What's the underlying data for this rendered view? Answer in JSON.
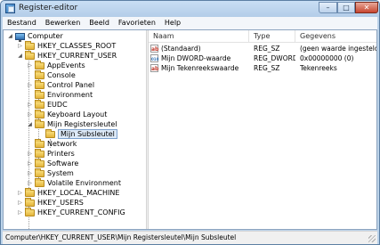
{
  "window": {
    "title": "Register-editor",
    "controls": {
      "minimize": "–",
      "maximize": "□",
      "close": "✕"
    }
  },
  "menu": [
    "Bestand",
    "Bewerken",
    "Beeld",
    "Favorieten",
    "Help"
  ],
  "tree": {
    "root": "Computer",
    "items": [
      {
        "label": "HKEY_CLASSES_ROOT",
        "expander": "▷"
      },
      {
        "label": "HKEY_CURRENT_USER",
        "expander": "◢"
      },
      {
        "label": "AppEvents",
        "expander": "▷"
      },
      {
        "label": "Console",
        "expander": ""
      },
      {
        "label": "Control Panel",
        "expander": "▷"
      },
      {
        "label": "Environment",
        "expander": ""
      },
      {
        "label": "EUDC",
        "expander": "▷"
      },
      {
        "label": "Keyboard Layout",
        "expander": "▷"
      },
      {
        "label": "Mijn Registersleutel",
        "expander": "◢"
      },
      {
        "label": "Mijn Subsleutel",
        "expander": ""
      },
      {
        "label": "Network",
        "expander": ""
      },
      {
        "label": "Printers",
        "expander": "▷"
      },
      {
        "label": "Software",
        "expander": "▷"
      },
      {
        "label": "System",
        "expander": "▷"
      },
      {
        "label": "Volatile Environment",
        "expander": "▷"
      },
      {
        "label": "HKEY_LOCAL_MACHINE",
        "expander": "▷"
      },
      {
        "label": "HKEY_USERS",
        "expander": "▷"
      },
      {
        "label": "HKEY_CURRENT_CONFIG",
        "expander": "▷"
      }
    ]
  },
  "list": {
    "columns": [
      "Naam",
      "Type",
      "Gegevens"
    ],
    "rows": [
      {
        "name": "(Standaard)",
        "type": "REG_SZ",
        "data": "(geen waarde ingesteld)",
        "icon": "ab"
      },
      {
        "name": "Mijn DWORD-waarde",
        "type": "REG_DWORD",
        "data": "0x00000000 (0)",
        "icon": "010"
      },
      {
        "name": "Mijn Tekenreekswaarde",
        "type": "REG_SZ",
        "data": "Tekenreeks",
        "icon": "ab"
      }
    ]
  },
  "status": "Computer\\HKEY_CURRENT_USER\\Mijn Registersleutel\\Mijn Subsleutel"
}
